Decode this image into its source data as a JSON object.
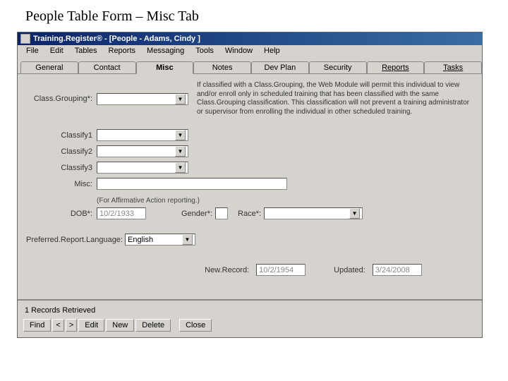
{
  "page_heading": "People Table Form – Misc Tab",
  "titlebar": "Training.Register® - [People - Adams, Cindy ]",
  "menu": {
    "file": "File",
    "edit": "Edit",
    "tables": "Tables",
    "reports": "Reports",
    "messaging": "Messaging",
    "tools": "Tools",
    "window": "Window",
    "help": "Help"
  },
  "tabs": {
    "general": "General",
    "contact": "Contact",
    "misc": "Misc",
    "notes": "Notes",
    "devplan": "Dev Plan",
    "security": "Security",
    "reports": "Reports",
    "tasks": "Tasks"
  },
  "labels": {
    "classgrouping": "Class.Grouping*:",
    "classify1": "Classify1",
    "classify2": "Classify2",
    "classify3": "Classify3",
    "misc": "Misc:",
    "aa_caption": "(For Affirmative Action reporting.)",
    "dob": "DOB*:",
    "gender": "Gender*:",
    "race": "Race*:",
    "preflang": "Preferred.Report.Language:",
    "newrecord": "New.Record:",
    "updated": "Updated:"
  },
  "help_text": "If classified with a Class.Grouping, the Web Module will permit this individual to view and/or enroll only in scheduled training that has been classified with the same Class.Grouping classification. This classification will not prevent a training administrator or supervisor from enrolling the individual in other scheduled training.",
  "values": {
    "classgrouping": "",
    "classify1": "",
    "classify2": "",
    "classify3": "",
    "misc": "",
    "dob": "10/2/1933",
    "gender": "",
    "race": "",
    "preflang": "English",
    "newrecord": "10/2/1954",
    "updated": "3/24/2008"
  },
  "status": "1 Records Retrieved",
  "buttons": {
    "find": "Find",
    "prev": "<",
    "next": ">",
    "edit": "Edit",
    "new": "New",
    "delete": "Delete",
    "close": "Close"
  }
}
